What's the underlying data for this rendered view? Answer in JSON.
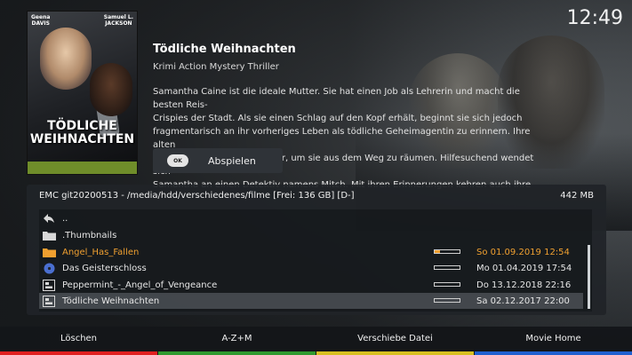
{
  "clock": "12:49",
  "poster": {
    "actor_left_first": "Geena",
    "actor_left_last": "DAVIS",
    "actor_right_first": "Samuel L.",
    "actor_right_last": "JACKSON",
    "title_line1": "TÖDLICHE",
    "title_line2": "WEIHNACHTEN"
  },
  "movie": {
    "title": "Tödliche Weihnachten",
    "genre": "Krimi Action Mystery Thriller",
    "description_lines": [
      "Samantha Caine ist die ideale Mutter. Sie hat einen Job als Lehrerin und macht die besten Reis-",
      "Crispies der Stadt. Als sie einen Schlag auf den Kopf erhält, beginnt sie sich jedoch",
      "fragmentarisch an ihr vorheriges Leben als tödliche Geheimagentin zu erinnern. Ihre alten",
      "Freude sind nun hinter ihr her, um sie aus dem Weg zu räumen. Hilfesuchend wendet sich",
      "Samantha an einen Detektiv namens Mitch. Mit ihren Erinnerungen kehren auch ihre"
    ]
  },
  "play_button": {
    "key": "OK",
    "label": "Abspielen"
  },
  "browser": {
    "path": "EMC git20200513 - /media/hdd/verschiedenes/filme [Frei: 136 GB] [D-]",
    "size": "442 MB",
    "rows": [
      {
        "icon": "back-arrow-icon",
        "name": "..",
        "date": "",
        "progress": null,
        "selected": false,
        "highlight": false
      },
      {
        "icon": "folder-icon",
        "name": ".Thumbnails",
        "date": "",
        "progress": null,
        "selected": false,
        "highlight": false
      },
      {
        "icon": "folder-icon",
        "name": "Angel_Has_Fallen",
        "date": "So 01.09.2019 12:54",
        "progress": 0.2,
        "selected": false,
        "highlight": true
      },
      {
        "icon": "dvd-icon",
        "name": "Das Geisterschloss",
        "date": "Mo 01.04.2019 17:54",
        "progress": 0,
        "selected": false,
        "highlight": false
      },
      {
        "icon": "movie-file-icon",
        "name": "Peppermint_-_Angel_of_Vengeance",
        "date": "Do 13.12.2018 22:16",
        "progress": 0,
        "selected": false,
        "highlight": false
      },
      {
        "icon": "movie-file-icon",
        "name": "Tödliche Weihnachten",
        "date": "Sa 02.12.2017 22:00",
        "progress": 0,
        "selected": true,
        "highlight": false
      }
    ]
  },
  "footer": [
    {
      "label": "Löschen",
      "color": "#e02020"
    },
    {
      "label": "A-Z+M",
      "color": "#2f9a2f"
    },
    {
      "label": "Verschiebe Datei",
      "color": "#d8c020"
    },
    {
      "label": "Movie Home",
      "color": "#2060d0"
    }
  ],
  "colors": {
    "highlight": "#f0a030"
  }
}
